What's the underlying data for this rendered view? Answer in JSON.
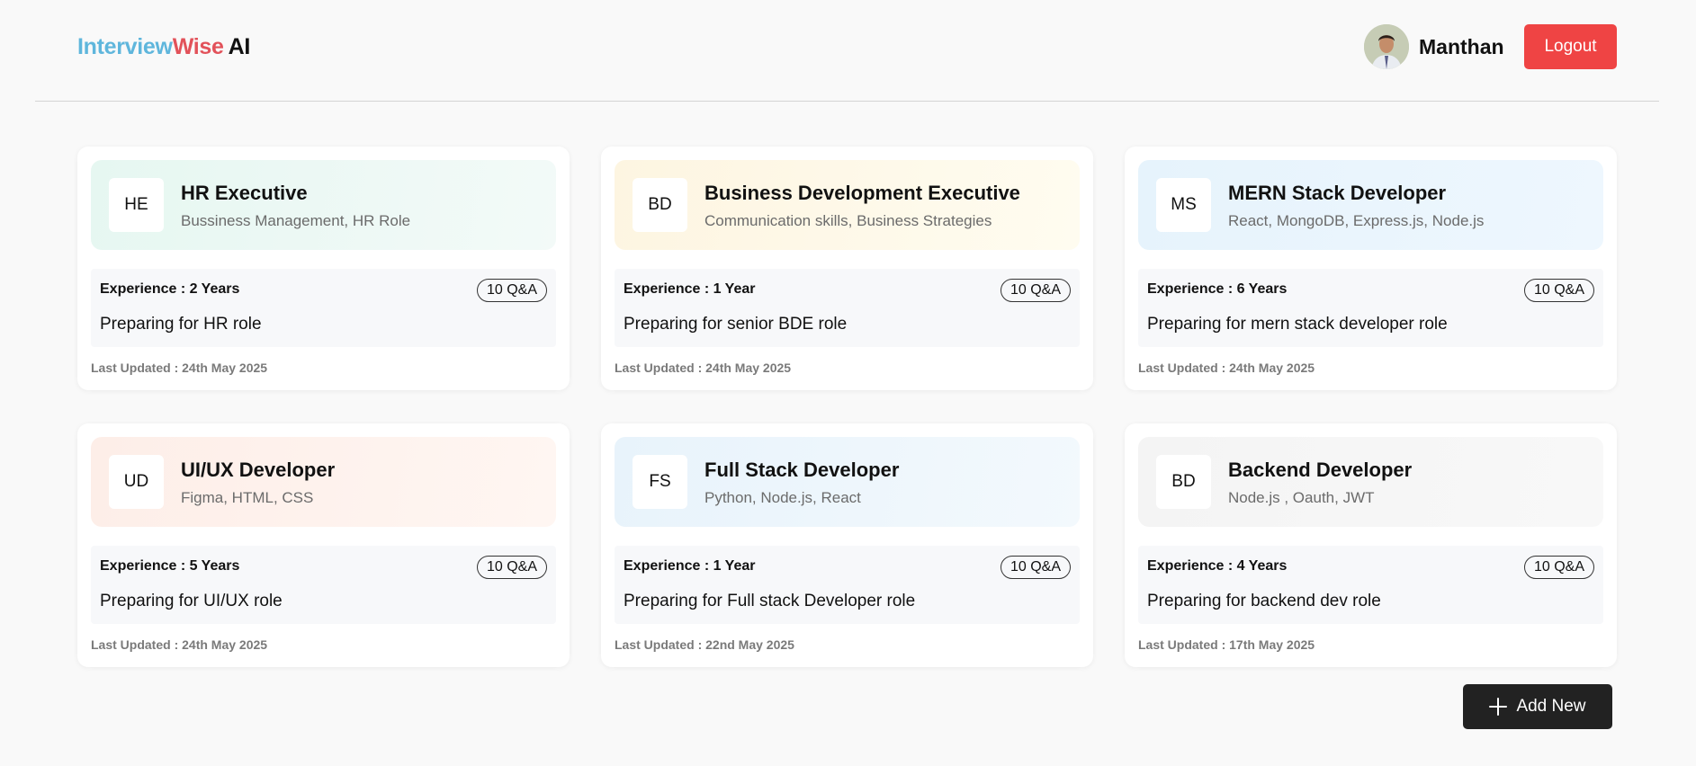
{
  "app": {
    "logo_part1": "Interview",
    "logo_part2": "Wise",
    "logo_part3": "AI"
  },
  "header": {
    "user_name": "Manthan",
    "logout_label": "Logout"
  },
  "cards": [
    {
      "initials": "HE",
      "role": "HR Executive",
      "topics": "Bussiness Management, HR Role",
      "experience": "Experience : 2 Years",
      "qa_count": "10 Q&A",
      "description": "Preparing for HR role",
      "last_updated": "Last Updated : 24th May 2025",
      "accent_from": "#e6f7f1",
      "accent_to": "#f3faf8"
    },
    {
      "initials": "BD",
      "role": "Business Development Executive",
      "topics": "Communication skills, Business Strategies",
      "experience": "Experience : 1 Year",
      "qa_count": "10 Q&A",
      "description": "Preparing for senior BDE role",
      "last_updated": "Last Updated : 24th May 2025",
      "accent_from": "#fdf5e1",
      "accent_to": "#fffcf0"
    },
    {
      "initials": "MS",
      "role": "MERN Stack Developer",
      "topics": "React, MongoDB, Express.js, Node.js",
      "experience": "Experience : 6 Years",
      "qa_count": "10 Q&A",
      "description": "Preparing for mern stack developer role",
      "last_updated": "Last Updated : 24th May 2025",
      "accent_from": "#e6f3fc",
      "accent_to": "#eef7fe"
    },
    {
      "initials": "UD",
      "role": "UI/UX Developer",
      "topics": "Figma, HTML, CSS",
      "experience": "Experience : 5 Years",
      "qa_count": "10 Q&A",
      "description": "Preparing for UI/UX role",
      "last_updated": "Last Updated : 24th May 2025",
      "accent_from": "#fdeee8",
      "accent_to": "#fff6f2"
    },
    {
      "initials": "FS",
      "role": "Full Stack Developer",
      "topics": "Python, Node.js, React",
      "experience": "Experience : 1 Year",
      "qa_count": "10 Q&A",
      "description": "Preparing for Full stack Developer role",
      "last_updated": "Last Updated : 22nd May 2025",
      "accent_from": "#e8f3fb",
      "accent_to": "#f3f9fd"
    },
    {
      "initials": "BD",
      "role": "Backend Developer",
      "topics": "Node.js , Oauth, JWT",
      "experience": "Experience : 4 Years",
      "qa_count": "10 Q&A",
      "description": "Preparing for backend dev role",
      "last_updated": "Last Updated : 17th May 2025",
      "accent_from": "#f4f4f4",
      "accent_to": "#f8f8f8"
    }
  ],
  "actions": {
    "add_new_label": "Add New"
  },
  "colors": {
    "logout_bg": "#ef4444",
    "add_new_bg": "#222222",
    "logo_interview": "#5fb6dc",
    "logo_wise": "#e2525a"
  }
}
